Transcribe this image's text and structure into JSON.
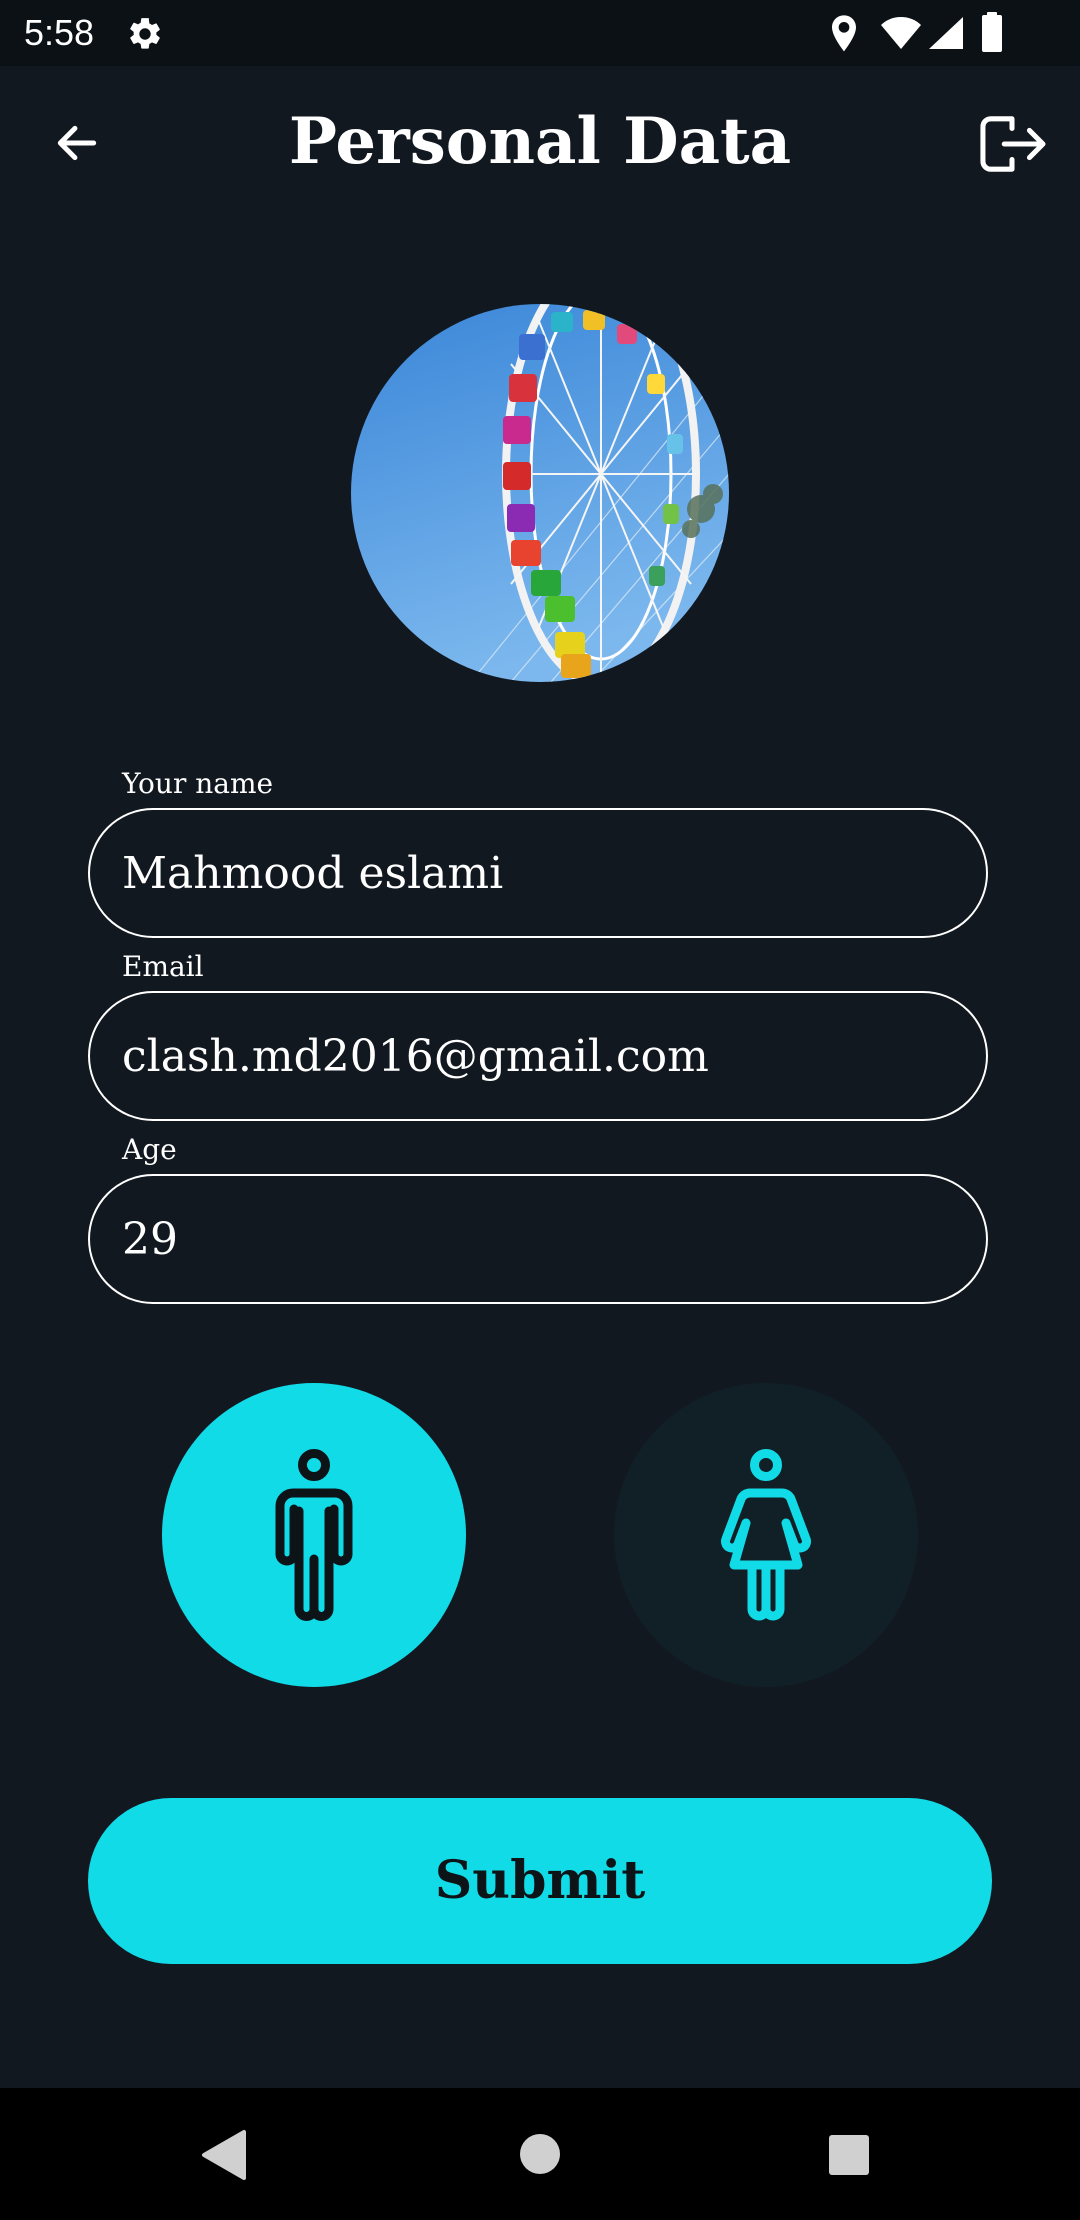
{
  "status_bar": {
    "time": "5:58",
    "icons": [
      "settings-gear-icon",
      "location-icon",
      "wifi-icon",
      "cell-signal-icon",
      "battery-icon"
    ]
  },
  "app_bar": {
    "title": "Personal Data",
    "back_icon": "arrow-left-icon",
    "logout_icon": "logout-icon"
  },
  "avatar": {
    "description_icon": "profile-photo-ferris-wheel"
  },
  "form": {
    "name": {
      "label": "Your name",
      "value": "Mahmood eslami"
    },
    "email": {
      "label": "Email",
      "value": "clash.md2016@gmail.com"
    },
    "age": {
      "label": "Age",
      "value": "29"
    }
  },
  "gender": {
    "options": [
      {
        "id": "male",
        "icon": "male-person-icon",
        "selected": true
      },
      {
        "id": "female",
        "icon": "female-person-icon",
        "selected": false
      }
    ]
  },
  "submit": {
    "label": "Submit"
  },
  "colors": {
    "background": "#121820",
    "accent": "#12dbe8",
    "unselected_circle": "#111f26",
    "text": "#ffffff",
    "nav_bar": "#000000"
  },
  "nav_bar": {
    "icons": [
      "nav-back-icon",
      "nav-home-icon",
      "nav-recents-icon"
    ]
  }
}
